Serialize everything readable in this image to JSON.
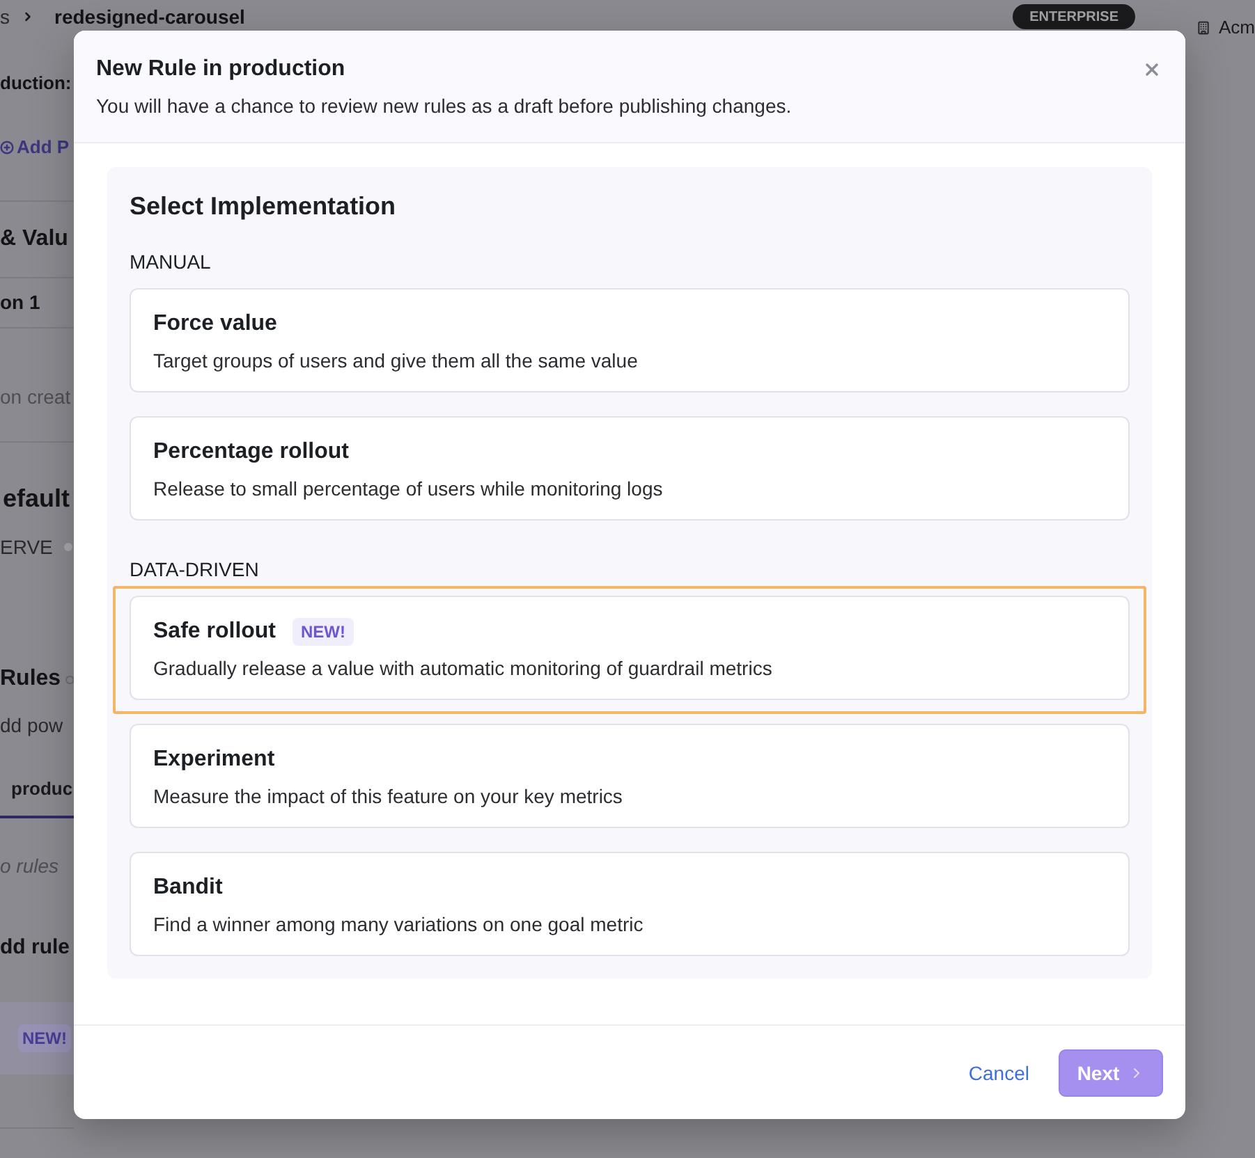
{
  "page": {
    "breadcrumb": {
      "parent": "s",
      "current": "redesigned-carousel"
    },
    "plan_badge": "ENTERPRISE",
    "organization": "Acm",
    "environment_label": "duction:",
    "add_link": "Add P",
    "values_title": "& Valu",
    "variation_row": "on 1",
    "values_note": "on creat",
    "default_title": "efault",
    "serve_label": "ERVE",
    "rules_title": "Rules",
    "rules_description": "dd pow",
    "environment_tabs": [
      {
        "label": "produc",
        "selected": true
      }
    ],
    "empty_text": "o rules",
    "add_rule_title": "dd rule",
    "new_badge": "NEW!"
  },
  "modal": {
    "title": "New Rule in production",
    "subtitle": "You will have a chance to review new rules as a draft before publishing changes.",
    "heading": "Select Implementation",
    "groups": [
      {
        "label": "MANUAL",
        "options": [
          {
            "title": "Force value",
            "description": "Target groups of users and give them all the same value",
            "selected": false
          },
          {
            "title": "Percentage rollout",
            "description": "Release to small percentage of users while monitoring logs",
            "selected": false
          }
        ]
      },
      {
        "label": "DATA-DRIVEN",
        "options": [
          {
            "title": "Safe rollout",
            "badge": "NEW!",
            "description": "Gradually release a value with automatic monitoring of guardrail metrics",
            "selected": true
          },
          {
            "title": "Experiment",
            "description": "Measure the impact of this feature on your key metrics",
            "selected": false
          },
          {
            "title": "Bandit",
            "description": "Find a winner among many variations on one goal metric",
            "selected": false
          }
        ]
      }
    ],
    "buttons": {
      "cancel": "Cancel",
      "next": "Next"
    }
  }
}
